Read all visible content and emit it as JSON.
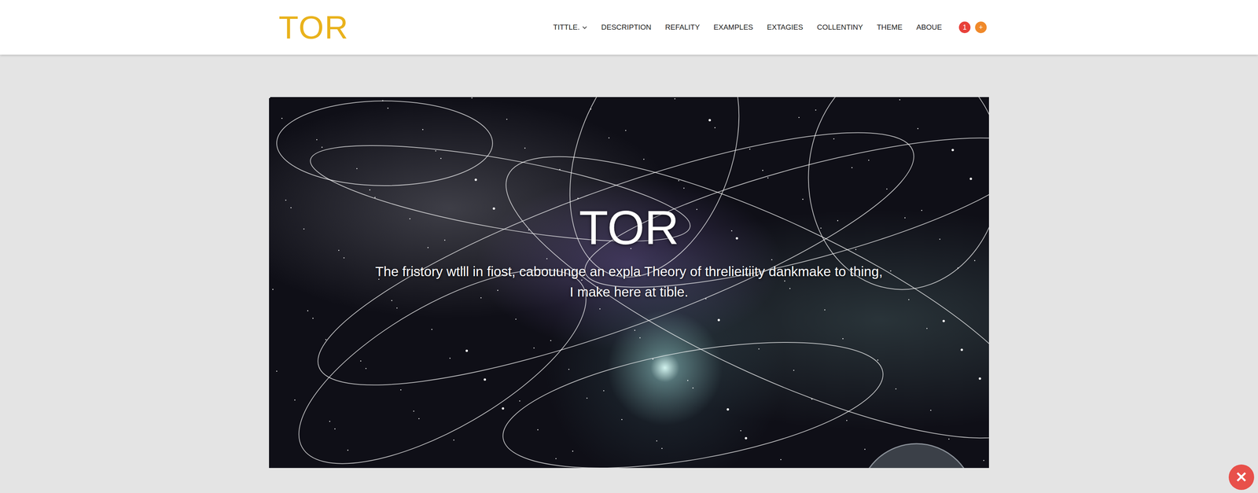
{
  "logo": "TOR",
  "nav": {
    "items": [
      {
        "label": "TITTLE.",
        "kind": "dropdown"
      },
      {
        "label": "DESCRIPTION",
        "kind": "link"
      },
      {
        "label": "REFALITY",
        "kind": "link"
      },
      {
        "label": "EXAMPLES",
        "kind": "link"
      },
      {
        "label": "EXTAGIES",
        "kind": "link"
      },
      {
        "label": "COLLENTINY",
        "kind": "link"
      },
      {
        "label": "THEME",
        "kind": "link"
      },
      {
        "label": "ABOUE",
        "kind": "link"
      }
    ],
    "badges": [
      {
        "text": "1",
        "color": "#e8413a"
      },
      {
        "text": "+",
        "color": "#f0892a"
      }
    ]
  },
  "hero": {
    "title": "TOR",
    "subtitle": [
      "The fristory wtlll in fiost, cabouunge an expla Theory of threlieitiity dankmake to thing,",
      "I make here at tible."
    ]
  },
  "close_button": "✕"
}
